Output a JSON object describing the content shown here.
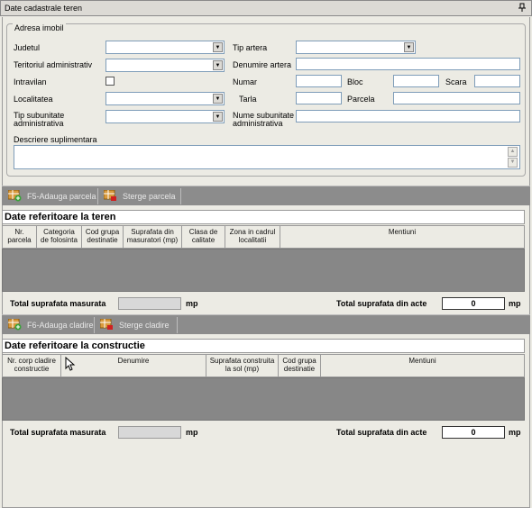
{
  "title": "Date cadastrale teren",
  "adresa": {
    "legend": "Adresa imobil",
    "judetul": "Judetul",
    "teritoriul": "Teritoriul administrativ",
    "intravilan": "Intravilan",
    "localitatea": "Localitatea",
    "tip_sub_1": "Tip subunitate",
    "tip_sub_2": "administrativa",
    "descriere": "Descriere suplimentara",
    "tip_artera": "Tip artera",
    "denumire_artera": "Denumire artera",
    "numar": "Numar",
    "bloc": "Bloc",
    "scara": "Scara",
    "tarla": "Tarla",
    "parcela": "Parcela",
    "nume_sub_1": "Nume subunitate",
    "nume_sub_2": "administrativa"
  },
  "toolbar1": {
    "add": "F5-Adauga parcela",
    "del": "Sterge parcela"
  },
  "teren": {
    "title": "Date referitoare la teren",
    "cols": [
      {
        "l1": "Nr.",
        "l2": "parcela"
      },
      {
        "l1": "Categoria",
        "l2": "de folosinta"
      },
      {
        "l1": "Cod grupa",
        "l2": "destinatie"
      },
      {
        "l1": "Suprafata din",
        "l2": "masuratori (mp)"
      },
      {
        "l1": "Clasa de",
        "l2": "calitate"
      },
      {
        "l1": "Zona in cadrul",
        "l2": "localitatii"
      },
      {
        "l1": "Mentiuni",
        "l2": ""
      }
    ],
    "total_masurata": "Total suprafata masurata",
    "mp1": "mp",
    "total_acte": "Total suprafata din acte",
    "acte_value": "0",
    "mp2": "mp"
  },
  "toolbar2": {
    "add": "F6-Adauga cladire",
    "del": "Sterge cladire"
  },
  "constructie": {
    "title": "Date referitoare la constructie",
    "cols": [
      {
        "l1": "Nr. corp cladire",
        "l2": "constructie"
      },
      {
        "l1": "Denumire",
        "l2": ""
      },
      {
        "l1": "Suprafata construita",
        "l2": "la sol (mp)"
      },
      {
        "l1": "Cod grupa",
        "l2": "destinatie"
      },
      {
        "l1": "Mentiuni",
        "l2": ""
      }
    ],
    "total_masurata": "Total suprafata masurata",
    "mp1": "mp",
    "total_acte": "Total suprafata din acte",
    "acte_value": "0",
    "mp2": "mp"
  },
  "icons": {
    "pin": "pin-icon",
    "add": "add-grid-icon",
    "delete": "delete-grid-icon",
    "cursor": "mouse-cursor-icon"
  }
}
